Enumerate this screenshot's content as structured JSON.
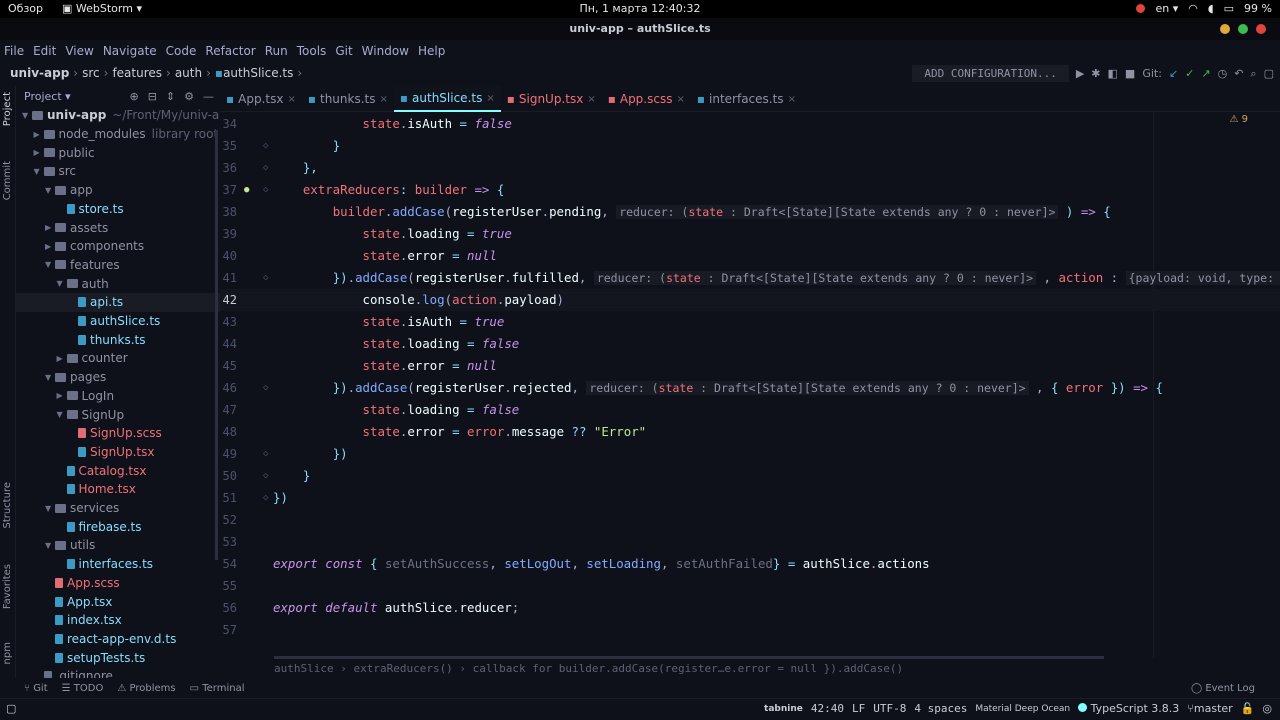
{
  "topbar": {
    "overview": "Обзор",
    "app": "WebStorm ▾",
    "clock": "Пн, 1 марта  12:40:32",
    "lang": "en ▾",
    "battery": "99 %"
  },
  "window": {
    "title": "univ-app – authSlice.ts"
  },
  "menu": [
    "File",
    "Edit",
    "View",
    "Navigate",
    "Code",
    "Refactor",
    "Run",
    "Tools",
    "Git",
    "Window",
    "Help"
  ],
  "breadcrumb": [
    "univ-app",
    "src",
    "features",
    "auth",
    "authSlice.ts"
  ],
  "runbar": {
    "add_config": "ADD CONFIGURATION...",
    "git_label": "Git:"
  },
  "left_strip": {
    "project": "Project",
    "commit": "Commit",
    "structure": "Structure",
    "favorites": "Favorites",
    "npm": "npm"
  },
  "project": {
    "header": "Project ▾",
    "items": [
      {
        "name": "univ-app",
        "extra": "~/Front/My/univ-a",
        "kind": "folder",
        "depth": 0,
        "open": true
      },
      {
        "name": "node_modules",
        "extra": "library root",
        "kind": "folder",
        "depth": 1,
        "open": false
      },
      {
        "name": "public",
        "kind": "folder",
        "depth": 1,
        "open": false
      },
      {
        "name": "src",
        "kind": "folder",
        "depth": 1,
        "open": true
      },
      {
        "name": "app",
        "kind": "folder",
        "depth": 2,
        "open": true
      },
      {
        "name": "store.ts",
        "kind": "ts",
        "depth": 3
      },
      {
        "name": "assets",
        "kind": "folder",
        "depth": 2,
        "open": false
      },
      {
        "name": "components",
        "kind": "folder",
        "depth": 2,
        "open": false
      },
      {
        "name": "features",
        "kind": "folder",
        "depth": 2,
        "open": true
      },
      {
        "name": "auth",
        "kind": "folder",
        "depth": 3,
        "open": true
      },
      {
        "name": "api.ts",
        "kind": "ts",
        "depth": 4,
        "selected": true
      },
      {
        "name": "authSlice.ts",
        "kind": "ts",
        "depth": 4
      },
      {
        "name": "thunks.ts",
        "kind": "ts",
        "depth": 4
      },
      {
        "name": "counter",
        "kind": "folder",
        "depth": 3,
        "open": false
      },
      {
        "name": "pages",
        "kind": "folder",
        "depth": 2,
        "open": true
      },
      {
        "name": "LogIn",
        "kind": "folder",
        "depth": 3,
        "open": false
      },
      {
        "name": "SignUp",
        "kind": "folder",
        "depth": 3,
        "open": true
      },
      {
        "name": "SignUp.scss",
        "kind": "scss",
        "depth": 4
      },
      {
        "name": "SignUp.tsx",
        "kind": "tsx",
        "depth": 4
      },
      {
        "name": "Catalog.tsx",
        "kind": "tsx",
        "depth": 3
      },
      {
        "name": "Home.tsx",
        "kind": "tsx",
        "depth": 3
      },
      {
        "name": "services",
        "kind": "folder",
        "depth": 2,
        "open": true
      },
      {
        "name": "firebase.ts",
        "kind": "ts",
        "depth": 3
      },
      {
        "name": "utils",
        "kind": "folder",
        "depth": 2,
        "open": true
      },
      {
        "name": "interfaces.ts",
        "kind": "ts",
        "depth": 3
      },
      {
        "name": "App.scss",
        "kind": "scss",
        "depth": 2
      },
      {
        "name": "App.tsx",
        "kind": "tsx",
        "depth": 2
      },
      {
        "name": "index.tsx",
        "kind": "tsx",
        "depth": 2
      },
      {
        "name": "react-app-env.d.ts",
        "kind": "ts",
        "depth": 2
      },
      {
        "name": "setupTests.ts",
        "kind": "ts",
        "depth": 2
      },
      {
        "name": ".gitignore",
        "kind": "git",
        "depth": 1
      }
    ]
  },
  "tabs": [
    {
      "label": "App.tsx",
      "kind": "tsx"
    },
    {
      "label": "thunks.ts",
      "kind": "ts"
    },
    {
      "label": "authSlice.ts",
      "kind": "ts",
      "active": true
    },
    {
      "label": "SignUp.tsx",
      "kind": "tsx-red"
    },
    {
      "label": "App.scss",
      "kind": "scss"
    },
    {
      "label": "interfaces.ts",
      "kind": "ts"
    }
  ],
  "editor": {
    "warnings": "⚠ 9",
    "current_line": 42,
    "lines": [
      {
        "n": "34",
        "html": "            <span class='pr'>state</span>.<span class='tx'>isAuth</span> <span class='p'>=</span> <span class='nu'>false</span>"
      },
      {
        "n": "35",
        "html": "        <span class='p'>}</span>"
      },
      {
        "n": "36",
        "html": "    <span class='p'>},</span>"
      },
      {
        "n": "37",
        "html": "    <span class='pr'>extraReducers</span><span class='p'>:</span> <span class='pr'>builder</span> <span class='kw'>=&gt;</span> <span class='p'>{</span>"
      },
      {
        "n": "38",
        "html": "        <span class='pr'>builder</span>.<span class='fn'>addCase</span>(<span class='tx'>registerUser</span>.<span class='tx'>pending</span>, <span class='hint'>reducer: (<span class='pr'>state</span> : Draft&lt;[State][State extends any ? 0 : never]&gt;</span> <span class='p'>)</span> <span class='kw'>=&gt;</span> <span class='p'>{</span>"
      },
      {
        "n": "39",
        "html": "            <span class='pr'>state</span>.<span class='tx'>loading</span> <span class='p'>=</span> <span class='nu'>true</span>"
      },
      {
        "n": "40",
        "html": "            <span class='pr'>state</span>.<span class='tx'>error</span> <span class='p'>=</span> <span class='nu'>null</span>"
      },
      {
        "n": "41",
        "html": "        <span class='p'>})</span>.<span class='fn'>addCase</span>(<span class='tx'>registerUser</span>.<span class='tx'>fulfilled</span>, <span class='hint'>reducer: (<span class='pr'>state</span> : Draft&lt;[State][State extends any ? 0 : never]&gt;</span> , <span class='pr'>action</span> : <span class='hint'>{payload: void, type: string</span>"
      },
      {
        "n": "42",
        "html": "            <span class='tx'>console</span>.<span class='fn'>log</span>(<span class='pr'>action</span>.<span class='tx'>payload</span>)"
      },
      {
        "n": "43",
        "html": "            <span class='pr'>state</span>.<span class='tx'>isAuth</span> <span class='p'>=</span> <span class='nu'>true</span>"
      },
      {
        "n": "44",
        "html": "            <span class='pr'>state</span>.<span class='tx'>loading</span> <span class='p'>=</span> <span class='nu'>false</span>"
      },
      {
        "n": "45",
        "html": "            <span class='pr'>state</span>.<span class='tx'>error</span> <span class='p'>=</span> <span class='nu'>null</span>"
      },
      {
        "n": "46",
        "html": "        <span class='p'>})</span>.<span class='fn'>addCase</span>(<span class='tx'>registerUser</span>.<span class='tx'>rejected</span>, <span class='hint'>reducer: (<span class='pr'>state</span> : Draft&lt;[State][State extends any ? 0 : never]&gt;</span> , <span class='p'>{</span> <span class='pr'>error</span> <span class='p'>})</span> <span class='kw'>=&gt;</span> <span class='p'>{</span>"
      },
      {
        "n": "47",
        "html": "            <span class='pr'>state</span>.<span class='tx'>loading</span> <span class='p'>=</span> <span class='nu'>false</span>"
      },
      {
        "n": "48",
        "html": "            <span class='pr'>state</span>.<span class='tx'>error</span> <span class='p'>=</span> <span class='pr'>error</span>.<span class='tx'>message</span> <span class='p'>??</span> <span class='st'>\"Error\"</span>"
      },
      {
        "n": "49",
        "html": "        <span class='p'>})</span>"
      },
      {
        "n": "50",
        "html": "    <span class='p'>}</span>"
      },
      {
        "n": "51",
        "html": "<span class='p'>})</span>"
      },
      {
        "n": "52",
        "html": ""
      },
      {
        "n": "53",
        "html": ""
      },
      {
        "n": "54",
        "html": "<span class='k'>export</span> <span class='k'>const</span> <span class='p'>{</span> <span class='ex'>setAuthSuccess</span>, <span class='fn'>setLogOut</span>, <span class='fn'>setLoading</span>, <span class='ex'>setAuthFailed</span><span class='p'>}</span> <span class='p'>=</span> <span class='tx'>authSlice</span>.<span class='tx'>actions</span>"
      },
      {
        "n": "55",
        "html": ""
      },
      {
        "n": "56",
        "html": "<span class='k'>export</span> <span class='k'>default</span> <span class='tx'>authSlice</span>.<span class='tx'>reducer</span>;"
      },
      {
        "n": "57",
        "html": ""
      }
    ]
  },
  "editor_breadcrumb": "authSlice › extraReducers() › callback for builder.addCase(register…e.error = null }).addCase()",
  "bottom_tools": [
    "Git",
    "TODO",
    "Problems",
    "Terminal"
  ],
  "event_log": "Event Log",
  "status": {
    "tabnine": "tabnine",
    "position": "42:40",
    "line_sep": "LF",
    "encoding": "UTF-8",
    "indent": "4 spaces",
    "theme": "Material Deep Ocean",
    "ts_version": "TypeScript 3.8.3",
    "branch": "master"
  },
  "colors": {
    "background": "#0f111a",
    "accent": "#84ffff",
    "keyword": "#c792ea",
    "property": "#f07178",
    "function": "#82aaff",
    "string": "#c3e88d"
  }
}
